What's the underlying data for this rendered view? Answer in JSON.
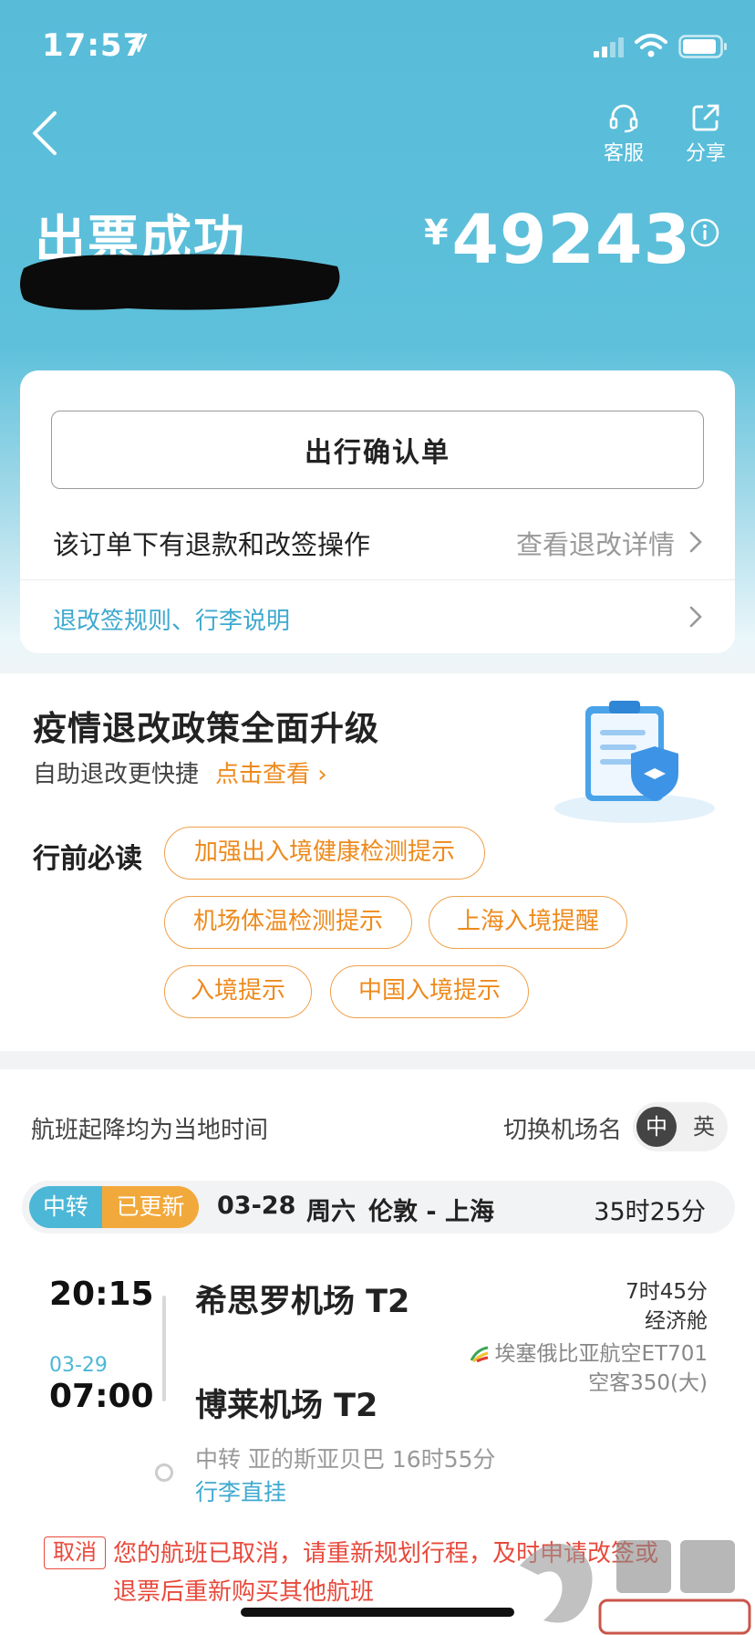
{
  "status_bar": {
    "time": "17:57"
  },
  "nav": {
    "service_label": "客服",
    "share_label": "分享"
  },
  "header": {
    "title": "出票成功",
    "currency": "¥",
    "price": "49243"
  },
  "card": {
    "confirm_button": "出行确认单",
    "refund_text": "该订单下有退款和改签操作",
    "refund_detail": "查看退改详情",
    "rules_link": "退改签规则、行李说明"
  },
  "policy": {
    "title": "疫情退改政策全面升级",
    "subtitle": "自助退改更快捷",
    "link": "点击查看",
    "must_read_label": "行前必读",
    "tags": [
      "加强出入境健康检测提示",
      "机场体温检测提示",
      "上海入境提醒",
      "入境提示",
      "中国入境提示"
    ]
  },
  "flight": {
    "local_time_note": "航班起降均为当地时间",
    "switch_label": "切换机场名",
    "lang_zh": "中",
    "lang_en": "英",
    "badge_transfer": "中转",
    "badge_updated": "已更新",
    "date": "03-28",
    "weekday": "周六",
    "cities": "伦敦 - 上海",
    "total_duration": "35时25分",
    "dep_time": "20:15",
    "dep_airport": "希思罗机场 T2",
    "leg_duration": "7时45分",
    "cabin": "经济舱",
    "airline": "埃塞俄比亚航空ET701",
    "aircraft": "空客350(大)",
    "arr_date": "03-29",
    "arr_time": "07:00",
    "arr_airport": "博莱机场 T2",
    "transfer_info": "中转 亚的斯亚贝巴 16时55分",
    "baggage": "行李直挂"
  },
  "cancel": {
    "badge": "取消",
    "message": "您的航班已取消，请重新规划行程，及时申请改签或退票后重新购买其他航班"
  },
  "colors": {
    "primary": "#58bcd9",
    "accent_orange": "#ee8a1c",
    "alert_red": "#e84a3c",
    "link_blue": "#3ea9cf"
  }
}
